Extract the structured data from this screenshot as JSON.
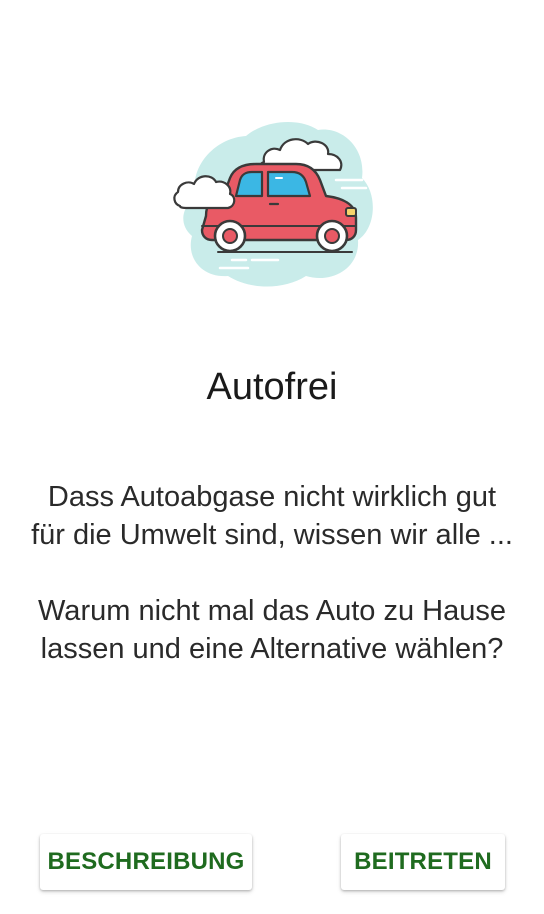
{
  "onboarding": {
    "illustration_icon": "car-with-clouds-icon",
    "title": "Autofrei",
    "description_paragraph_1": "Dass Autoabgase nicht wirklich gut für die Umwelt sind, wissen wir alle ...",
    "description_paragraph_2": "Warum nicht mal das Auto zu Hause lassen und eine Alternative wählen?"
  },
  "actions": {
    "left_button_label": "BESCHREIBUNG",
    "right_button_label": "BEITRETEN"
  },
  "colors": {
    "button_text": "#1f6b1f",
    "car_body": "#e95a65",
    "cloud_backdrop": "#c9ecea",
    "window": "#3bb7e4"
  }
}
